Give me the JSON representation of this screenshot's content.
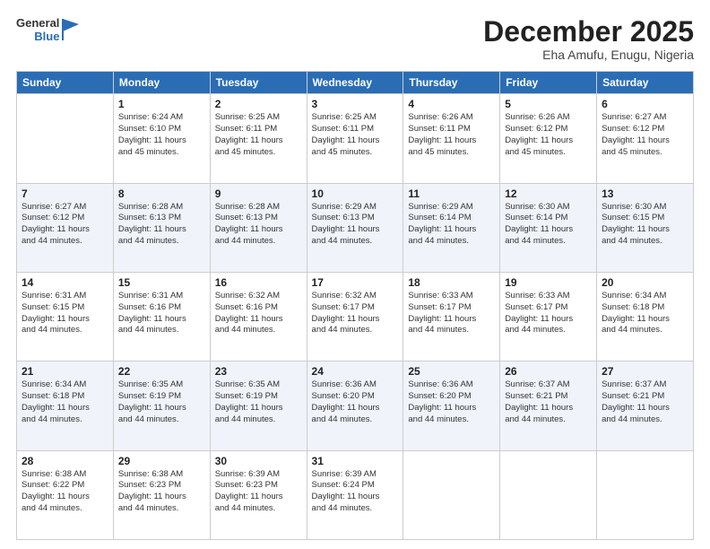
{
  "header": {
    "logo_general": "General",
    "logo_blue": "Blue",
    "month": "December 2025",
    "location": "Eha Amufu, Enugu, Nigeria"
  },
  "weekdays": [
    "Sunday",
    "Monday",
    "Tuesday",
    "Wednesday",
    "Thursday",
    "Friday",
    "Saturday"
  ],
  "weeks": [
    [
      {
        "day": "",
        "info": ""
      },
      {
        "day": "1",
        "info": "Sunrise: 6:24 AM\nSunset: 6:10 PM\nDaylight: 11 hours\nand 45 minutes."
      },
      {
        "day": "2",
        "info": "Sunrise: 6:25 AM\nSunset: 6:11 PM\nDaylight: 11 hours\nand 45 minutes."
      },
      {
        "day": "3",
        "info": "Sunrise: 6:25 AM\nSunset: 6:11 PM\nDaylight: 11 hours\nand 45 minutes."
      },
      {
        "day": "4",
        "info": "Sunrise: 6:26 AM\nSunset: 6:11 PM\nDaylight: 11 hours\nand 45 minutes."
      },
      {
        "day": "5",
        "info": "Sunrise: 6:26 AM\nSunset: 6:12 PM\nDaylight: 11 hours\nand 45 minutes."
      },
      {
        "day": "6",
        "info": "Sunrise: 6:27 AM\nSunset: 6:12 PM\nDaylight: 11 hours\nand 45 minutes."
      }
    ],
    [
      {
        "day": "7",
        "info": "Sunrise: 6:27 AM\nSunset: 6:12 PM\nDaylight: 11 hours\nand 44 minutes."
      },
      {
        "day": "8",
        "info": "Sunrise: 6:28 AM\nSunset: 6:13 PM\nDaylight: 11 hours\nand 44 minutes."
      },
      {
        "day": "9",
        "info": "Sunrise: 6:28 AM\nSunset: 6:13 PM\nDaylight: 11 hours\nand 44 minutes."
      },
      {
        "day": "10",
        "info": "Sunrise: 6:29 AM\nSunset: 6:13 PM\nDaylight: 11 hours\nand 44 minutes."
      },
      {
        "day": "11",
        "info": "Sunrise: 6:29 AM\nSunset: 6:14 PM\nDaylight: 11 hours\nand 44 minutes."
      },
      {
        "day": "12",
        "info": "Sunrise: 6:30 AM\nSunset: 6:14 PM\nDaylight: 11 hours\nand 44 minutes."
      },
      {
        "day": "13",
        "info": "Sunrise: 6:30 AM\nSunset: 6:15 PM\nDaylight: 11 hours\nand 44 minutes."
      }
    ],
    [
      {
        "day": "14",
        "info": "Sunrise: 6:31 AM\nSunset: 6:15 PM\nDaylight: 11 hours\nand 44 minutes."
      },
      {
        "day": "15",
        "info": "Sunrise: 6:31 AM\nSunset: 6:16 PM\nDaylight: 11 hours\nand 44 minutes."
      },
      {
        "day": "16",
        "info": "Sunrise: 6:32 AM\nSunset: 6:16 PM\nDaylight: 11 hours\nand 44 minutes."
      },
      {
        "day": "17",
        "info": "Sunrise: 6:32 AM\nSunset: 6:17 PM\nDaylight: 11 hours\nand 44 minutes."
      },
      {
        "day": "18",
        "info": "Sunrise: 6:33 AM\nSunset: 6:17 PM\nDaylight: 11 hours\nand 44 minutes."
      },
      {
        "day": "19",
        "info": "Sunrise: 6:33 AM\nSunset: 6:17 PM\nDaylight: 11 hours\nand 44 minutes."
      },
      {
        "day": "20",
        "info": "Sunrise: 6:34 AM\nSunset: 6:18 PM\nDaylight: 11 hours\nand 44 minutes."
      }
    ],
    [
      {
        "day": "21",
        "info": "Sunrise: 6:34 AM\nSunset: 6:18 PM\nDaylight: 11 hours\nand 44 minutes."
      },
      {
        "day": "22",
        "info": "Sunrise: 6:35 AM\nSunset: 6:19 PM\nDaylight: 11 hours\nand 44 minutes."
      },
      {
        "day": "23",
        "info": "Sunrise: 6:35 AM\nSunset: 6:19 PM\nDaylight: 11 hours\nand 44 minutes."
      },
      {
        "day": "24",
        "info": "Sunrise: 6:36 AM\nSunset: 6:20 PM\nDaylight: 11 hours\nand 44 minutes."
      },
      {
        "day": "25",
        "info": "Sunrise: 6:36 AM\nSunset: 6:20 PM\nDaylight: 11 hours\nand 44 minutes."
      },
      {
        "day": "26",
        "info": "Sunrise: 6:37 AM\nSunset: 6:21 PM\nDaylight: 11 hours\nand 44 minutes."
      },
      {
        "day": "27",
        "info": "Sunrise: 6:37 AM\nSunset: 6:21 PM\nDaylight: 11 hours\nand 44 minutes."
      }
    ],
    [
      {
        "day": "28",
        "info": "Sunrise: 6:38 AM\nSunset: 6:22 PM\nDaylight: 11 hours\nand 44 minutes."
      },
      {
        "day": "29",
        "info": "Sunrise: 6:38 AM\nSunset: 6:23 PM\nDaylight: 11 hours\nand 44 minutes."
      },
      {
        "day": "30",
        "info": "Sunrise: 6:39 AM\nSunset: 6:23 PM\nDaylight: 11 hours\nand 44 minutes."
      },
      {
        "day": "31",
        "info": "Sunrise: 6:39 AM\nSunset: 6:24 PM\nDaylight: 11 hours\nand 44 minutes."
      },
      {
        "day": "",
        "info": ""
      },
      {
        "day": "",
        "info": ""
      },
      {
        "day": "",
        "info": ""
      }
    ]
  ]
}
